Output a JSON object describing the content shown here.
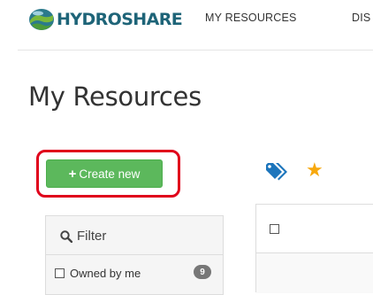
{
  "header": {
    "logo_text": "HYDROSHARE",
    "nav": [
      {
        "label": "MY RESOURCES"
      },
      {
        "label": "DIS"
      }
    ]
  },
  "page": {
    "title": "My Resources"
  },
  "toolbar": {
    "create_label": "Create new",
    "create_icon": "plus-icon",
    "tag_icon": "tags-icon",
    "star_icon": "star-icon"
  },
  "filter": {
    "title": "Filter",
    "owned_by_me_label": "Owned by me",
    "owned_by_me_count": "9",
    "owned_by_me_checked": false
  },
  "table": {
    "select_all_checked": false
  },
  "colors": {
    "brand": "#1e6478",
    "create_button": "#5cb85c",
    "highlight": "#e0001b",
    "tag_icon": "#1c75bc",
    "star": "#f7a80d"
  }
}
